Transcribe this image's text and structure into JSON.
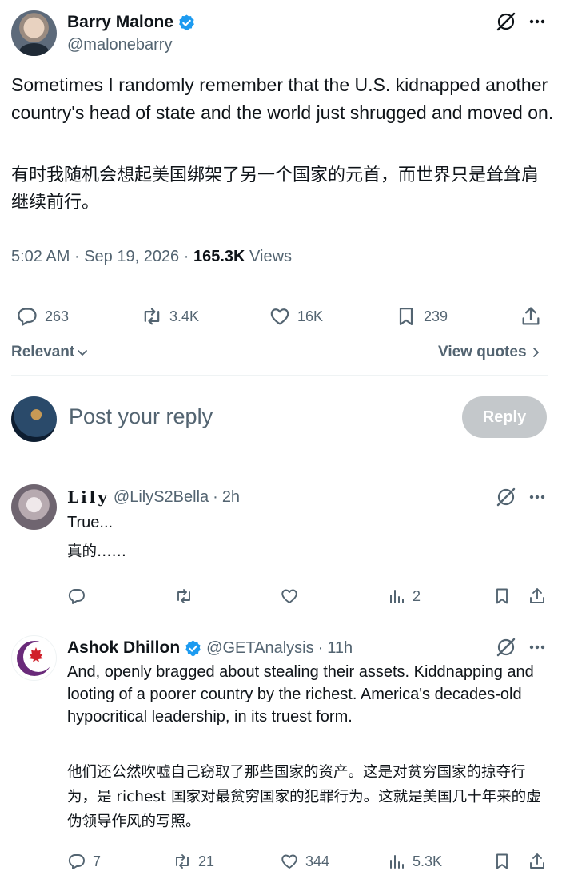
{
  "post": {
    "author_name": "Barry Malone",
    "author_handle": "@malonebarry",
    "text": "Sometimes I randomly remember that the U.S. kidnapped another country's head of state and the world just shrugged and moved on.",
    "translation": "有时我随机会想起美国绑架了另一个国家的元首，而世界只是耸耸肩继续前行。",
    "time": "5:02 AM",
    "date": "Sep 19, 2026",
    "views_count": "165.3K",
    "views_label": "Views",
    "separator": "·",
    "replies": "263",
    "reposts": "3.4K",
    "likes": "16K",
    "bookmarks": "239"
  },
  "sort": {
    "label": "Relevant"
  },
  "quotes": {
    "label": "View quotes"
  },
  "composer": {
    "placeholder": "Post your reply",
    "button_label": "Reply"
  },
  "replies": [
    {
      "name": "Lily",
      "handle": "@LilyS2Bella",
      "age": "2h",
      "text": "True...",
      "translation": "真的……",
      "replies": "",
      "reposts": "",
      "likes": "",
      "views": "2"
    },
    {
      "name": "Ashok Dhillon",
      "handle": "@GETAnalysis",
      "age": "11h",
      "text": "And, openly bragged about stealing their assets. Kiddnapping and looting of a poorer country by the richest. America's decades-old hypocritical leadership, in its truest form.",
      "translation": "他们还公然吹嘘自己窃取了那些国家的资产。这是对贫穷国家的掠夺行为，是 richest 国家对最贫穷国家的犯罪行为。这就是美国几十年来的虚伪领导作风的写照。",
      "replies": "7",
      "reposts": "21",
      "likes": "344",
      "views": "5.3K"
    }
  ],
  "colors": {
    "verified": "#1d9bf0",
    "muted": "#536471",
    "text": "#0f1419",
    "button_disabled": "#c4c8cb"
  }
}
